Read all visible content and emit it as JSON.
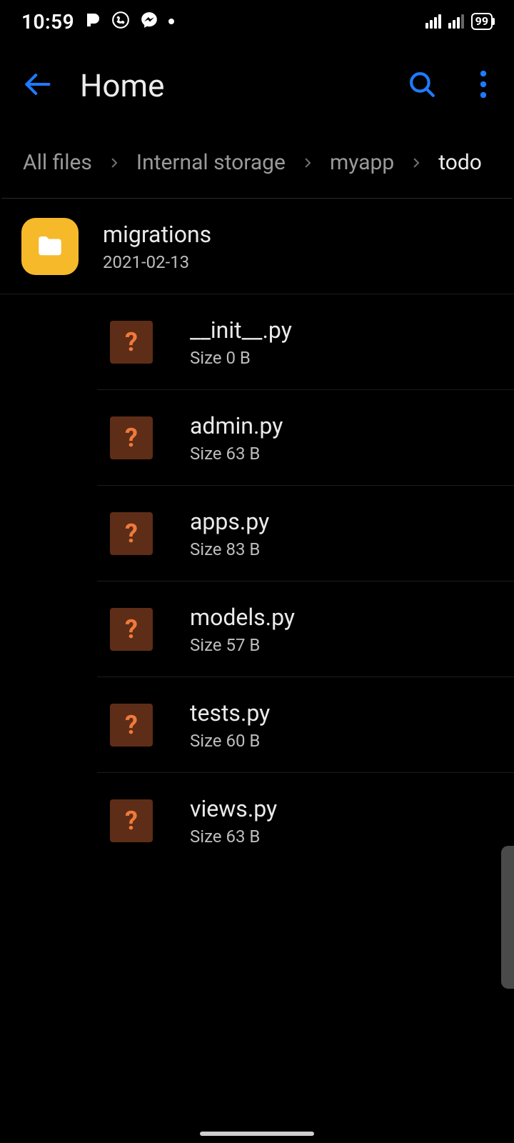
{
  "status": {
    "time": "10:59",
    "battery_level": "99"
  },
  "header": {
    "title": "Home"
  },
  "breadcrumb": {
    "items": [
      {
        "label": "All files",
        "current": false
      },
      {
        "label": "Internal storage",
        "current": false
      },
      {
        "label": "myapp",
        "current": false
      },
      {
        "label": "todo",
        "current": true
      }
    ]
  },
  "files": [
    {
      "type": "folder",
      "name": "migrations",
      "sub": "2021-02-13"
    },
    {
      "type": "file",
      "name": "__init__.py",
      "sub": "Size 0 B"
    },
    {
      "type": "file",
      "name": "admin.py",
      "sub": "Size 63 B"
    },
    {
      "type": "file",
      "name": "apps.py",
      "sub": "Size 83 B"
    },
    {
      "type": "file",
      "name": "models.py",
      "sub": "Size 57 B"
    },
    {
      "type": "file",
      "name": "tests.py",
      "sub": "Size 60 B"
    },
    {
      "type": "file",
      "name": "views.py",
      "sub": "Size 63 B"
    }
  ],
  "icons": {
    "unknown_glyph": "?"
  }
}
